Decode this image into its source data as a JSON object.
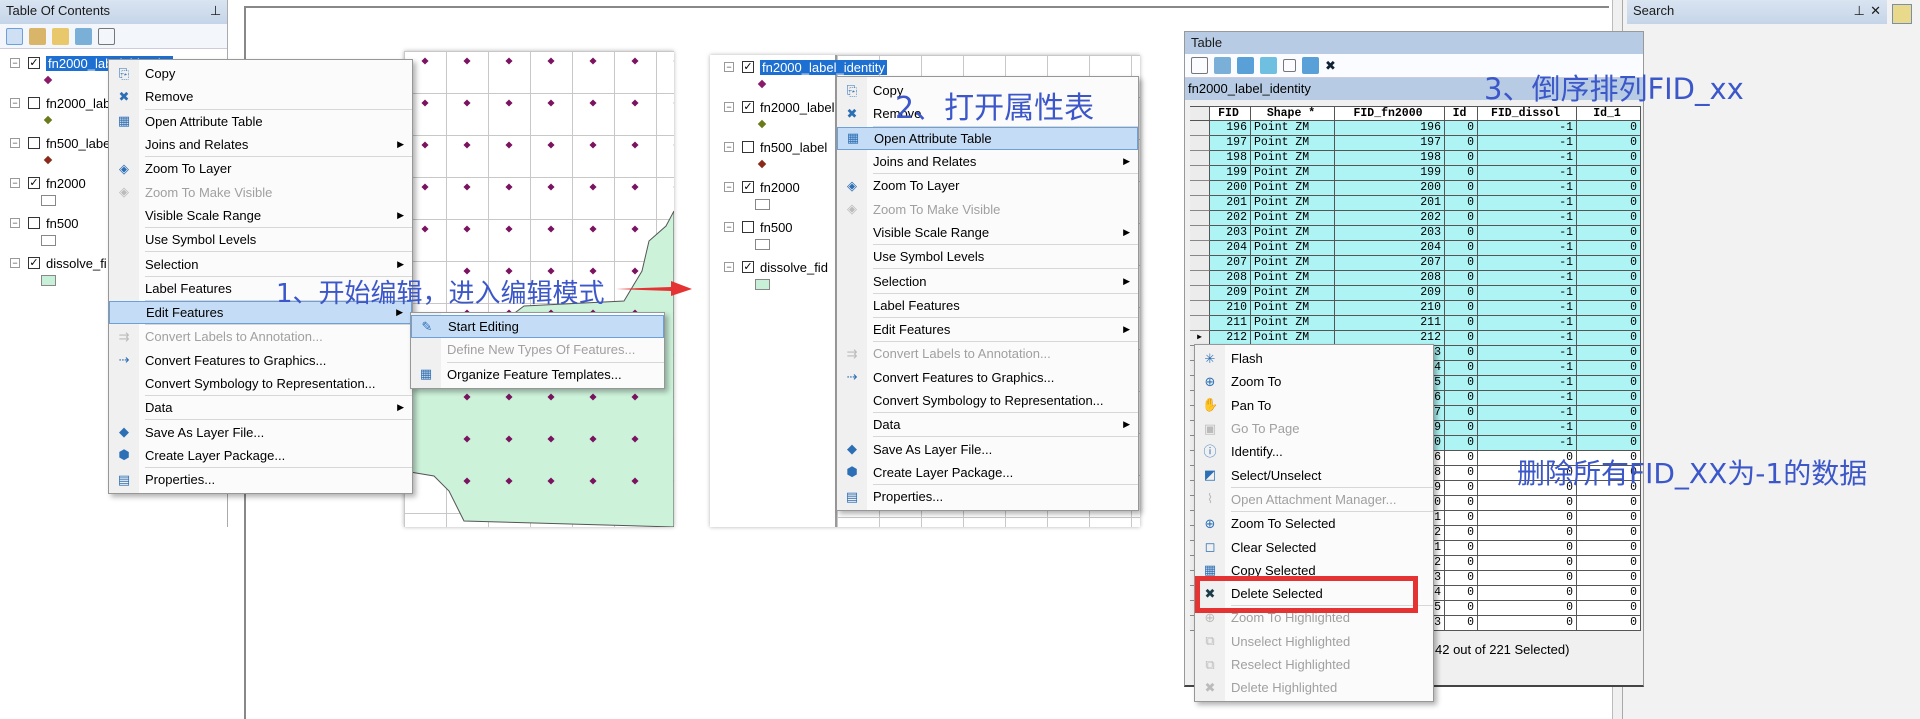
{
  "colors": {
    "selection": "#1d6fd1",
    "menu_highlight": "#c4dcf5",
    "row_selected": "#aef4f4",
    "annotation": "#3b57c9",
    "red": "#e53333",
    "polygon": "#ccf2da",
    "point": "#7a1360"
  },
  "toc": {
    "title": "Table Of Contents",
    "layers": [
      {
        "name": "fn2000_label_identity",
        "symbol": "point",
        "symbol_color": "#8b1a6b"
      },
      {
        "name": "fn2000_label",
        "symbol": "point",
        "symbol_color": "#6b7a1a"
      },
      {
        "name": "fn500_label",
        "symbol": "point",
        "symbol_color": "#8b2a1a"
      },
      {
        "name": "fn2000",
        "symbol": "box",
        "symbol_color": "#ffffff"
      },
      {
        "name": "fn500",
        "symbol": "box",
        "symbol_color": "#ffffff"
      },
      {
        "name": "dissolve_fid",
        "symbol": "box",
        "symbol_color": "#c8f0d8"
      }
    ],
    "left_checked": [
      true,
      false,
      false,
      true,
      false,
      true
    ],
    "left_names": [
      "fn2000_label_identity",
      "fn2000_lab",
      "fn500_labe",
      "fn2000",
      "fn500",
      "dissolve_fi"
    ],
    "mid_checked": [
      true,
      true,
      false,
      true,
      false,
      true
    ]
  },
  "layer_menu": [
    {
      "label": "Copy",
      "icon": "copy-icon",
      "glyph": "⎘"
    },
    {
      "label": "Remove",
      "icon": "remove-icon",
      "glyph": "✖",
      "sep": true
    },
    {
      "label": "Open Attribute Table",
      "icon": "table-icon",
      "glyph": "▦"
    },
    {
      "label": "Joins and Relates",
      "sub": true,
      "sep": true
    },
    {
      "label": "Zoom To Layer",
      "icon": "zoom-layer-icon",
      "glyph": "◈"
    },
    {
      "label": "Zoom To Make Visible",
      "icon": "zoom-visible-icon",
      "glyph": "◈",
      "disabled": true
    },
    {
      "label": "Visible Scale Range",
      "sub": true,
      "sep": true
    },
    {
      "label": "Use Symbol Levels",
      "sep": true
    },
    {
      "label": "Selection",
      "sub": true,
      "sep": true
    },
    {
      "label": "Label Features",
      "sep": true
    },
    {
      "label": "Edit Features",
      "sub": true,
      "sep": true
    },
    {
      "label": "Convert Labels to Annotation...",
      "icon": "convert-labels-icon",
      "glyph": "⇉",
      "disabled": true
    },
    {
      "label": "Convert Features to Graphics...",
      "icon": "convert-graphics-icon",
      "glyph": "⇢"
    },
    {
      "label": "Convert Symbology to Representation...",
      "sep": true
    },
    {
      "label": "Data",
      "sub": true,
      "sep": true
    },
    {
      "label": "Save As Layer File...",
      "icon": "layer-file-icon",
      "glyph": "◆"
    },
    {
      "label": "Create Layer Package...",
      "icon": "layer-package-icon",
      "glyph": "⬢",
      "sep": true
    },
    {
      "label": "Properties...",
      "icon": "properties-icon",
      "glyph": "▤"
    }
  ],
  "edit_submenu": [
    {
      "label": "Start Editing",
      "icon": "pencil-icon",
      "glyph": "✎"
    },
    {
      "label": "Define New Types Of Features...",
      "disabled": true,
      "sep": true
    },
    {
      "label": "Organize Feature Templates...",
      "icon": "templates-icon",
      "glyph": "▦"
    }
  ],
  "annotations": {
    "step1": "1、开始编辑，进入编辑模式",
    "step2": "2、打开属性表",
    "step3": "3、倒序排列FID_xx",
    "step4": "删除所有FID_XX为-1的数据"
  },
  "table": {
    "window_title": "Table",
    "layer_name": "fn2000_label_identity",
    "columns": [
      "FID",
      "Shape *",
      "FID_fn2000",
      "Id",
      "FID_dissol",
      "Id_1"
    ],
    "rows": [
      [
        "196",
        "Point ZM",
        "196",
        "0",
        "-1",
        "0"
      ],
      [
        "197",
        "Point ZM",
        "197",
        "0",
        "-1",
        "0"
      ],
      [
        "198",
        "Point ZM",
        "198",
        "0",
        "-1",
        "0"
      ],
      [
        "199",
        "Point ZM",
        "199",
        "0",
        "-1",
        "0"
      ],
      [
        "200",
        "Point ZM",
        "200",
        "0",
        "-1",
        "0"
      ],
      [
        "201",
        "Point ZM",
        "201",
        "0",
        "-1",
        "0"
      ],
      [
        "202",
        "Point ZM",
        "202",
        "0",
        "-1",
        "0"
      ],
      [
        "203",
        "Point ZM",
        "203",
        "0",
        "-1",
        "0"
      ],
      [
        "204",
        "Point ZM",
        "204",
        "0",
        "-1",
        "0"
      ],
      [
        "207",
        "Point ZM",
        "207",
        "0",
        "-1",
        "0"
      ],
      [
        "208",
        "Point ZM",
        "208",
        "0",
        "-1",
        "0"
      ],
      [
        "209",
        "Point ZM",
        "209",
        "0",
        "-1",
        "0"
      ],
      [
        "210",
        "Point ZM",
        "210",
        "0",
        "-1",
        "0"
      ],
      [
        "211",
        "Point ZM",
        "211",
        "0",
        "-1",
        "0"
      ],
      [
        "212",
        "Point ZM",
        "212",
        "0",
        "-1",
        "0"
      ],
      [
        "",
        "",
        "3",
        "0",
        "-1",
        "0"
      ],
      [
        "",
        "",
        "4",
        "0",
        "-1",
        "0"
      ],
      [
        "",
        "",
        "5",
        "0",
        "-1",
        "0"
      ],
      [
        "",
        "",
        "6",
        "0",
        "-1",
        "0"
      ],
      [
        "",
        "",
        "7",
        "0",
        "-1",
        "0"
      ],
      [
        "",
        "",
        "9",
        "0",
        "-1",
        "0"
      ],
      [
        "",
        "",
        "0",
        "0",
        "-1",
        "0"
      ],
      [
        "",
        "",
        "6",
        "0",
        "0",
        "0"
      ],
      [
        "",
        "",
        "8",
        "0",
        "0",
        "0"
      ],
      [
        "",
        "",
        "9",
        "0",
        "0",
        "0"
      ],
      [
        "",
        "",
        "0",
        "0",
        "0",
        "0"
      ],
      [
        "",
        "",
        "1",
        "0",
        "0",
        "0"
      ],
      [
        "",
        "",
        "2",
        "0",
        "0",
        "0"
      ],
      [
        "",
        "",
        "1",
        "0",
        "0",
        "0"
      ],
      [
        "",
        "",
        "2",
        "0",
        "0",
        "0"
      ],
      [
        "",
        "",
        "3",
        "0",
        "0",
        "0"
      ],
      [
        "",
        "",
        "4",
        "0",
        "0",
        "0"
      ],
      [
        "",
        "",
        "5",
        "0",
        "0",
        "0"
      ],
      [
        "",
        "",
        "3",
        "0",
        "0",
        "0"
      ]
    ],
    "selected_row_count": 22,
    "current_row": "212",
    "status": "42 out of 221 Selected)"
  },
  "row_menu": [
    {
      "label": "Flash",
      "icon": "flash-icon",
      "glyph": "✳"
    },
    {
      "label": "Zoom To",
      "icon": "zoom-in-icon",
      "glyph": "⊕"
    },
    {
      "label": "Pan To",
      "icon": "pan-hand-icon",
      "glyph": "✋"
    },
    {
      "label": "Go To Page",
      "icon": "page-icon",
      "glyph": "▣",
      "disabled": true
    },
    {
      "label": "Identify...",
      "icon": "identify-icon",
      "glyph": "ⓘ"
    },
    {
      "label": "Select/Unselect",
      "icon": "select-icon",
      "glyph": "◩",
      "sep": true
    },
    {
      "label": "Open Attachment Manager...",
      "icon": "paperclip-icon",
      "glyph": "⌇",
      "disabled": true,
      "sep": true
    },
    {
      "label": "Zoom To Selected",
      "icon": "zoom-selected-icon",
      "glyph": "⊕"
    },
    {
      "label": "Clear Selected",
      "icon": "clear-selected-icon",
      "glyph": "◻"
    },
    {
      "label": "Copy Selected",
      "icon": "copy-selected-icon",
      "glyph": "▦"
    },
    {
      "label": "Delete Selected",
      "icon": "delete-icon",
      "glyph": "✖",
      "sep": true
    },
    {
      "label": "Zoom To Highlighted",
      "icon": "zoom-highlighted-icon",
      "glyph": "⊕",
      "disabled": true
    },
    {
      "label": "Unselect Highlighted",
      "icon": "unselect-highlighted-icon",
      "glyph": "⧉",
      "disabled": true
    },
    {
      "label": "Reselect Highlighted",
      "icon": "reselect-highlighted-icon",
      "glyph": "⧉",
      "disabled": true
    },
    {
      "label": "Delete Highlighted",
      "icon": "delete-highlighted-icon",
      "glyph": "✖",
      "disabled": true
    }
  ],
  "search_panel": {
    "title": "Search"
  }
}
